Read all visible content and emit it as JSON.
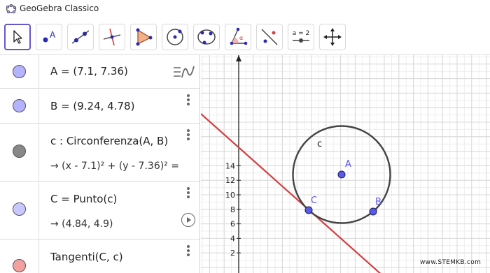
{
  "window": {
    "title": "GeoGebra Classico"
  },
  "toolbar": {
    "tools": [
      {
        "name": "move-tool",
        "icon": "cursor-arrow-icon",
        "active": true
      },
      {
        "name": "point-tool",
        "icon": "point-a-icon"
      },
      {
        "name": "line-tool",
        "icon": "line-through-points-icon"
      },
      {
        "name": "perpendicular-tool",
        "icon": "perpendicular-line-icon"
      },
      {
        "name": "polygon-tool",
        "icon": "polygon-icon"
      },
      {
        "name": "circle-center-point-tool",
        "icon": "circle-center-icon"
      },
      {
        "name": "circle-three-points-tool",
        "icon": "circle-three-points-icon"
      },
      {
        "name": "angle-tool",
        "icon": "angle-icon",
        "label": "α"
      },
      {
        "name": "reflect-tool",
        "icon": "reflect-icon"
      },
      {
        "name": "slider-tool",
        "icon": "slider-icon",
        "label": "a = 2"
      },
      {
        "name": "move-graphics-tool",
        "icon": "move-graphics-icon"
      }
    ]
  },
  "algebra": {
    "rows": [
      {
        "def": "A = (7.1, 7.36)",
        "color": "#b3b3ff"
      },
      {
        "def": "B = (9.24, 4.78)",
        "color": "#b3b3ff"
      },
      {
        "def": "c : Circonferenza(A, B)",
        "value": "→   (x - 7.1)² + (y - 7.36)² =",
        "color": "#888888"
      },
      {
        "def": "C = Punto(c)",
        "value": "→   (4.84, 4.9)",
        "color": "#c8c8ff"
      },
      {
        "def": "Tangenti(C, c)",
        "color": "#f2a0a0"
      }
    ]
  },
  "graphics": {
    "y_ticks": [
      "2",
      "4",
      "6",
      "8",
      "10",
      "12",
      "14"
    ],
    "labels": {
      "circle": "c",
      "A": "A",
      "B": "B",
      "C": "C"
    },
    "colors": {
      "point": "#5a5ae6",
      "circle": "#444444",
      "tangent": "#d63f3f",
      "grid": "#e6e6e6"
    }
  },
  "footer": {
    "watermark": "www.STEMKB.com"
  }
}
